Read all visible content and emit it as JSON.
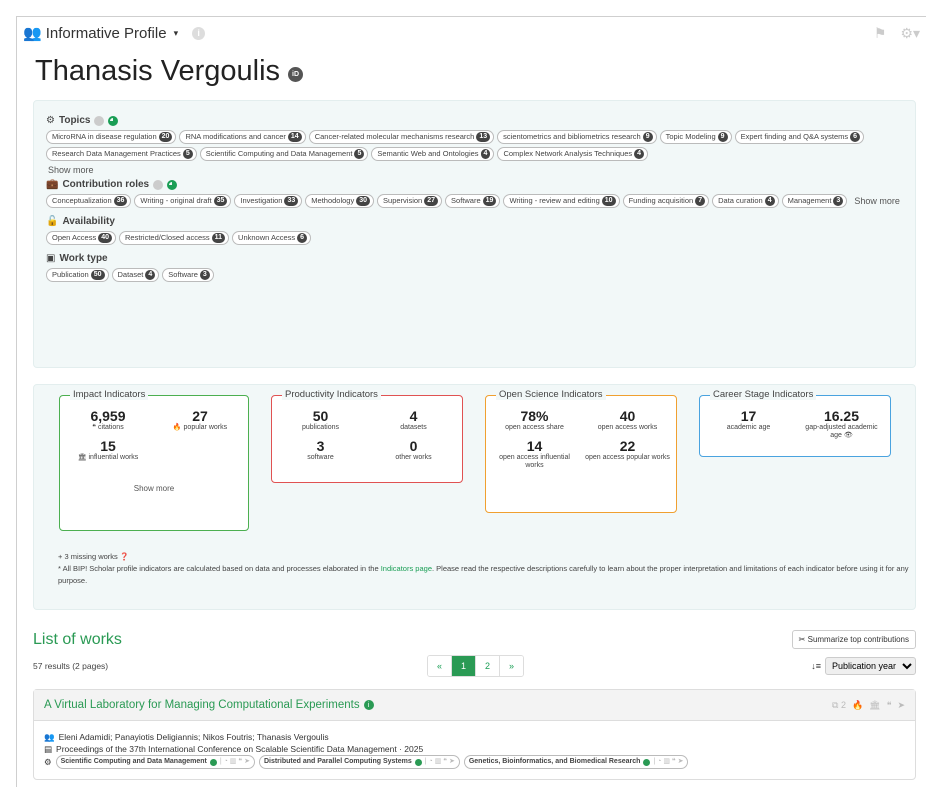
{
  "topbar": {
    "brand": "Informative Profile",
    "caret": "▾"
  },
  "profile": {
    "name": "Thanasis Vergoulis",
    "id_badge": "iD"
  },
  "facets": {
    "topics": {
      "title": "Topics",
      "chips": [
        {
          "label": "MicroRNA in disease regulation",
          "count": "20"
        },
        {
          "label": "RNA modifications and cancer",
          "count": "14"
        },
        {
          "label": "Cancer-related molecular mechanisms research",
          "count": "13"
        },
        {
          "label": "scientometrics and bibliometrics research",
          "count": "9"
        },
        {
          "label": "Topic Modeling",
          "count": "9"
        },
        {
          "label": "Expert finding and Q&A systems",
          "count": "6"
        },
        {
          "label": "Research Data Management Practices",
          "count": "5"
        },
        {
          "label": "Scientific Computing and Data Management",
          "count": "5"
        },
        {
          "label": "Semantic Web and Ontologies",
          "count": "4"
        },
        {
          "label": "Complex Network Analysis Techniques",
          "count": "4"
        }
      ],
      "show_more": "Show more"
    },
    "roles": {
      "title": "Contribution roles",
      "chips": [
        {
          "label": "Conceptualization",
          "count": "36"
        },
        {
          "label": "Writing - original draft",
          "count": "35"
        },
        {
          "label": "Investigation",
          "count": "33"
        },
        {
          "label": "Methodology",
          "count": "30"
        },
        {
          "label": "Supervision",
          "count": "27"
        },
        {
          "label": "Software",
          "count": "19"
        },
        {
          "label": "Writing - review and editing",
          "count": "10"
        },
        {
          "label": "Funding acquisition",
          "count": "7"
        },
        {
          "label": "Data curation",
          "count": "4"
        },
        {
          "label": "Management",
          "count": "3"
        }
      ],
      "show_more": "Show more"
    },
    "availability": {
      "title": "Availability",
      "chips": [
        {
          "label": "Open Access",
          "count": "40"
        },
        {
          "label": "Restricted/Closed access",
          "count": "11"
        },
        {
          "label": "Unknown Access",
          "count": "6"
        }
      ]
    },
    "work_type": {
      "title": "Work type",
      "chips": [
        {
          "label": "Publication",
          "count": "50"
        },
        {
          "label": "Dataset",
          "count": "4"
        },
        {
          "label": "Software",
          "count": "3"
        }
      ]
    }
  },
  "indicators": {
    "impact": {
      "title": "Impact Indicators",
      "items": [
        {
          "value": "6,959",
          "label": "❝ citations"
        },
        {
          "value": "27",
          "label": "🔥 popular works"
        },
        {
          "value": "15",
          "label": "🏛 influential works"
        }
      ],
      "show_more": "Show more",
      "color": "#4caf50"
    },
    "productivity": {
      "title": "Productivity Indicators",
      "items": [
        {
          "value": "50",
          "label": "publications"
        },
        {
          "value": "4",
          "label": "datasets"
        },
        {
          "value": "3",
          "label": "software"
        },
        {
          "value": "0",
          "label": "other works"
        }
      ],
      "color": "#e05252"
    },
    "open_science": {
      "title": "Open Science Indicators",
      "items": [
        {
          "value": "78%",
          "label": "open access share"
        },
        {
          "value": "40",
          "label": "open access works"
        },
        {
          "value": "14",
          "label": "open access influential works"
        },
        {
          "value": "22",
          "label": "open access popular works"
        }
      ],
      "color": "#f0a030"
    },
    "career": {
      "title": "Career Stage Indicators",
      "items": [
        {
          "value": "17",
          "label": "academic age"
        },
        {
          "value": "16.25",
          "label": "gap-adjusted academic age 👁"
        }
      ],
      "color": "#4aa3df"
    },
    "missing": "+ 3 missing works",
    "note_prefix": "* All BIP! Scholar profile indicators are calculated based on data and processes elaborated in the ",
    "note_link": "Indicators page",
    "note_suffix": ". Please read the respective descriptions carefully to learn about the proper interpretation and limitations of each indicator before using it for any purpose."
  },
  "works": {
    "title": "List of works",
    "summarize_label": "Summarize top contributions",
    "results": "57 results (2 pages)",
    "pager": [
      "«",
      "1",
      "2",
      "»"
    ],
    "sort_label": "Publication year",
    "first": {
      "title": "A Virtual Laboratory for Managing Computational Experiments",
      "version_count": "2",
      "authors": "Eleni Adamidi; Panayiotis Deligiannis; Nikos Foutris; Thanasis Vergoulis",
      "venue": "Proceedings of the 37th International Conference on Scalable Scientific Data Management · 2025",
      "tags": [
        "Scientific Computing and Data Management",
        "Distributed and Parallel Computing Systems",
        "Genetics, Bioinformatics, and Biomedical Research"
      ]
    }
  }
}
